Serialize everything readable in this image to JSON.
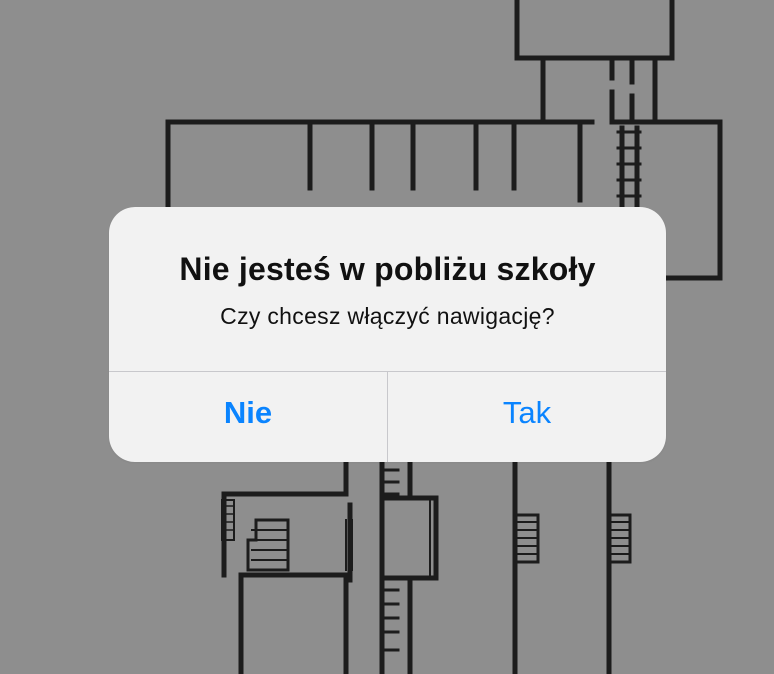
{
  "alert": {
    "title": "Nie jesteś w pobliżu szkoły",
    "message": "Czy chcesz włączyć nawigację?",
    "buttons": {
      "cancel_label": "Nie",
      "confirm_label": "Tak"
    }
  },
  "colors": {
    "backdrop": "#8e8e8e",
    "alert_background": "#f2f2f2",
    "button_text": "#0a84ff",
    "floorplan_lines": "#1c1c1c"
  }
}
